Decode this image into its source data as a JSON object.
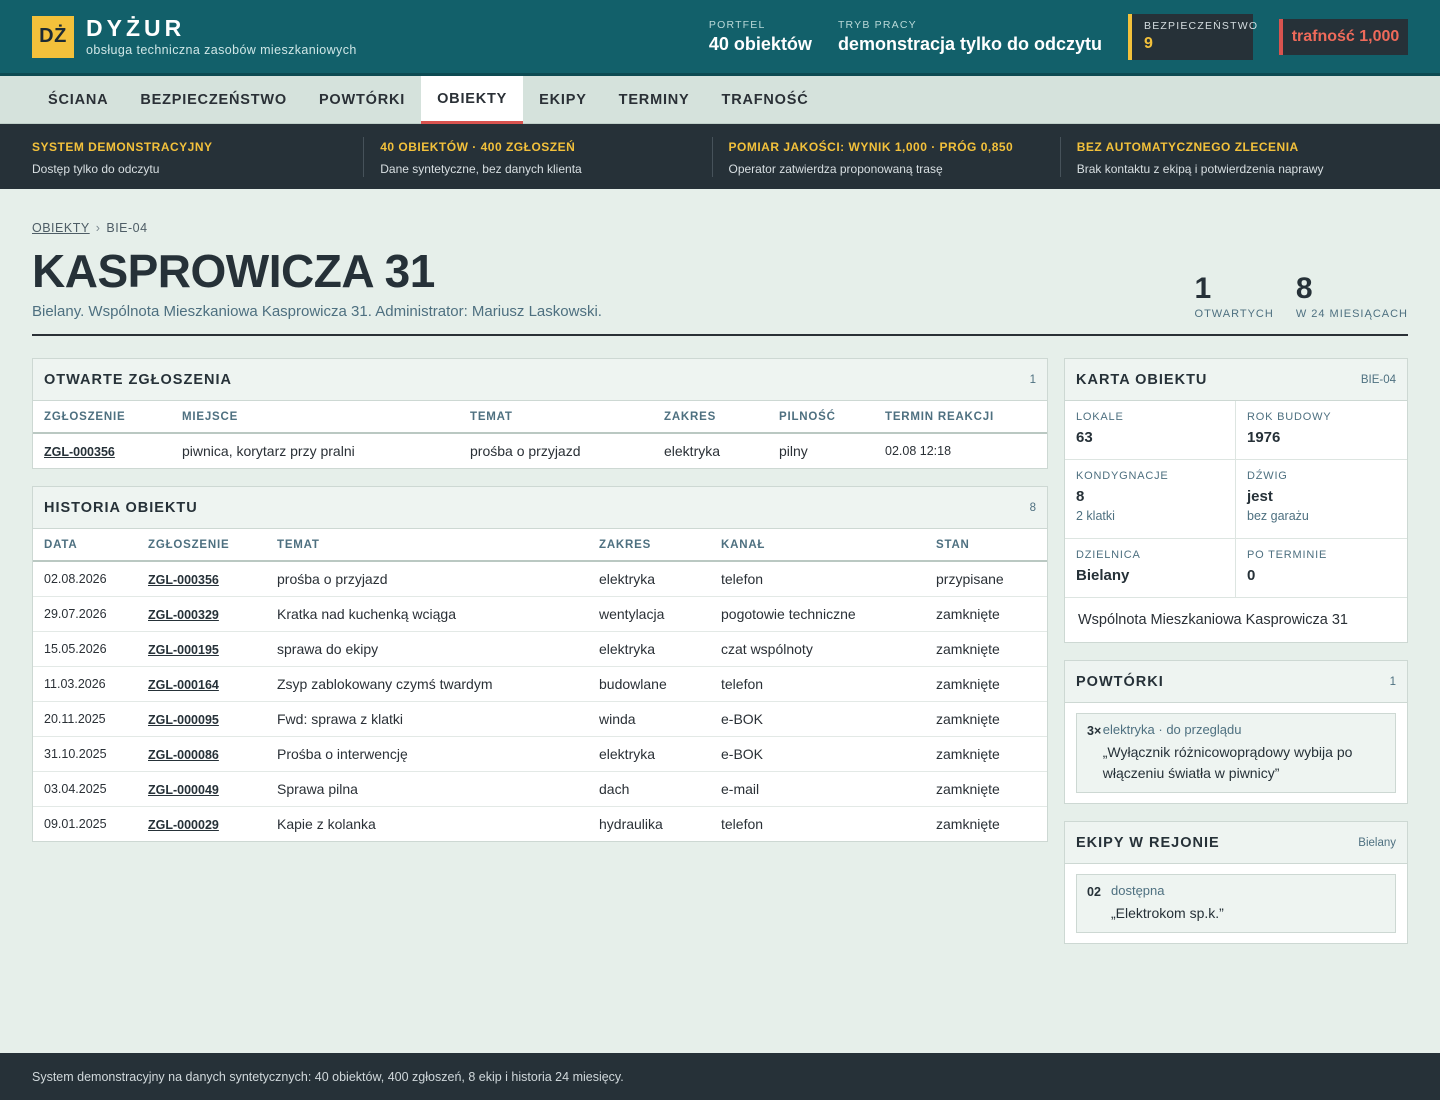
{
  "header": {
    "logo": "DŻ",
    "brand_name": "DYŻUR",
    "brand_sub": "obsługa techniczna zasobów mieszkaniowych",
    "portfolio_label": "PORTFEL",
    "portfolio_value": "40 obiektów",
    "mode_label": "TRYB PRACY",
    "mode_value": "demonstracja tylko do odczytu",
    "safety_label": "BEZPIECZEŃSTWO",
    "safety_value": "9",
    "accuracy": "trafność 1,000"
  },
  "nav": {
    "tabs": [
      "ŚCIANA",
      "BEZPIECZEŃSTWO",
      "POWTÓRKI",
      "OBIEKTY",
      "EKIPY",
      "TERMINY",
      "TRAFNOŚĆ"
    ],
    "active": "OBIEKTY"
  },
  "strip": [
    {
      "title": "SYSTEM DEMONSTRACYJNY",
      "desc": "Dostęp tylko do odczytu"
    },
    {
      "title": "40 OBIEKTÓW · 400 ZGŁOSZEŃ",
      "desc": "Dane syntetyczne, bez danych klienta"
    },
    {
      "title": "POMIAR JAKOŚCI: WYNIK 1,000 · PRÓG 0,850",
      "desc": "Operator zatwierdza proponowaną trasę"
    },
    {
      "title": "BEZ AUTOMATYCZNEGO ZLECENIA",
      "desc": "Brak kontaktu z ekipą i potwierdzenia naprawy"
    }
  ],
  "breadcrumb": {
    "root": "OBIEKTY",
    "sep": "›",
    "current": "BIE-04"
  },
  "page": {
    "title": "KASPROWICZA 31",
    "subtitle": "Bielany. Wspólnota Mieszkaniowa Kasprowicza 31. Administrator: Mariusz Laskowski.",
    "counters": [
      {
        "value": "1",
        "label": "OTWARTYCH"
      },
      {
        "value": "8",
        "label": "W 24 MIESIĄCACH"
      }
    ]
  },
  "open": {
    "title": "OTWARTE ZGŁOSZENIA",
    "count": "1",
    "headers": [
      "ZGŁOSZENIE",
      "MIEJSCE",
      "TEMAT",
      "ZAKRES",
      "PILNOŚĆ",
      "TERMIN REAKCJI"
    ],
    "rows": [
      {
        "id": "ZGL-000356",
        "place": "piwnica, korytarz przy pralni",
        "topic": "prośba o przyjazd",
        "scope": "elektryka",
        "urgency": "pilny",
        "deadline": "02.08 12:18"
      }
    ]
  },
  "history": {
    "title": "HISTORIA OBIEKTU",
    "count": "8",
    "headers": [
      "DATA",
      "ZGŁOSZENIE",
      "TEMAT",
      "ZAKRES",
      "KANAŁ",
      "STAN"
    ],
    "rows": [
      {
        "date": "02.08.2026",
        "id": "ZGL-000356",
        "topic": "prośba o przyjazd",
        "scope": "elektryka",
        "channel": "telefon",
        "state": "przypisane"
      },
      {
        "date": "29.07.2026",
        "id": "ZGL-000329",
        "topic": "Kratka nad kuchenką wciąga",
        "scope": "wentylacja",
        "channel": "pogotowie techniczne",
        "state": "zamknięte"
      },
      {
        "date": "15.05.2026",
        "id": "ZGL-000195",
        "topic": "sprawa do ekipy",
        "scope": "elektryka",
        "channel": "czat wspólnoty",
        "state": "zamknięte"
      },
      {
        "date": "11.03.2026",
        "id": "ZGL-000164",
        "topic": "Zsyp zablokowany czymś twardym",
        "scope": "budowlane",
        "channel": "telefon",
        "state": "zamknięte"
      },
      {
        "date": "20.11.2025",
        "id": "ZGL-000095",
        "topic": "Fwd: sprawa z klatki",
        "scope": "winda",
        "channel": "e-BOK",
        "state": "zamknięte"
      },
      {
        "date": "31.10.2025",
        "id": "ZGL-000086",
        "topic": "Prośba o interwencję",
        "scope": "elektryka",
        "channel": "e-BOK",
        "state": "zamknięte"
      },
      {
        "date": "03.04.2025",
        "id": "ZGL-000049",
        "topic": "Sprawa pilna",
        "scope": "dach",
        "channel": "e-mail",
        "state": "zamknięte"
      },
      {
        "date": "09.01.2025",
        "id": "ZGL-000029",
        "topic": "Kapie z kolanka",
        "scope": "hydraulika",
        "channel": "telefon",
        "state": "zamknięte"
      }
    ]
  },
  "card": {
    "title": "KARTA OBIEKTU",
    "code": "BIE-04",
    "cells": [
      {
        "label": "LOKALE",
        "value": "63",
        "sub": ""
      },
      {
        "label": "ROK BUDOWY",
        "value": "1976",
        "sub": ""
      },
      {
        "label": "KONDYGNACJE",
        "value": "8",
        "sub": "2 klatki"
      },
      {
        "label": "DŹWIG",
        "value": "jest",
        "sub": "bez garażu"
      },
      {
        "label": "DZIELNICA",
        "value": "Bielany",
        "sub": ""
      },
      {
        "label": "PO TERMINIE",
        "value": "0",
        "sub": ""
      }
    ],
    "footer": "Wspólnota Mieszkaniowa Kasprowicza 31"
  },
  "repeats": {
    "title": "POWTÓRKI",
    "count": "1",
    "items": [
      {
        "tag": "3×",
        "meta": "elektryka · do przeglądu",
        "text": "„Wyłącznik różnicowoprądowy wybija po włączeniu światła w piwnicy”"
      }
    ]
  },
  "crews": {
    "title": "EKIPY W REJONIE",
    "region": "Bielany",
    "items": [
      {
        "tag": "02",
        "meta": "dostępna",
        "text": "„Elektrokom sp.k.”"
      }
    ]
  },
  "footer": "System demonstracyjny na danych syntetycznych: 40 obiektów, 400 zgłoszeń, 8 ekip i historia 24 miesięcy."
}
